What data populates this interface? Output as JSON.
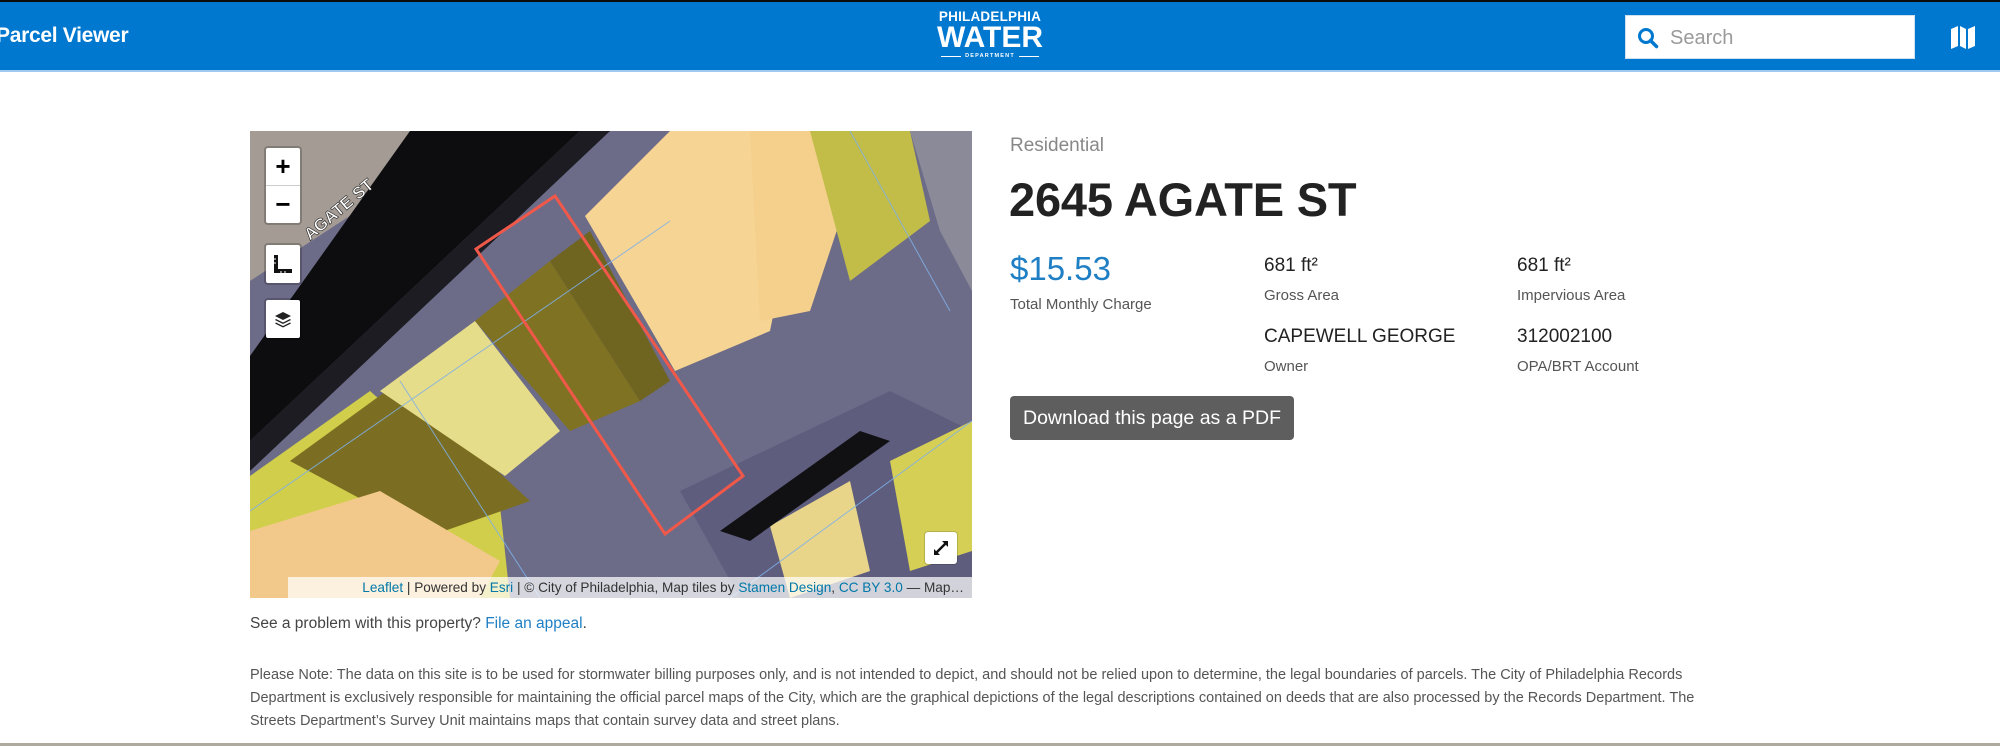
{
  "header": {
    "app_title": "Parcel Viewer",
    "logo": {
      "line1": "PHILADELPHIA",
      "line2": "WATER",
      "line3": "DEPARTMENT"
    },
    "search": {
      "placeholder": "Search",
      "value": "",
      "icon": "search-icon"
    },
    "map_button_icon": "map-icon",
    "colors": {
      "brand": "#0078cf"
    }
  },
  "map": {
    "street_label": "AGATE ST",
    "controls": {
      "zoom_in": "+",
      "zoom_out": "−",
      "measure_icon": "ruler-square-icon",
      "layers_icon": "layers-icon",
      "fullscreen_icon": "expand-icon"
    },
    "attribution": {
      "leaflet": "Leaflet",
      "sep1": " | Powered by ",
      "esri": "Esri",
      "sep2": " | © City of Philadelphia, Map tiles by ",
      "stamen": "Stamen Design",
      "sep3": ", ",
      "license": "CC BY 3.0",
      "tail": " — Map…"
    },
    "colors": {
      "selected_parcel_outline": "#f0584a",
      "parcel_fill": "#f6d494",
      "impervious_fill": "#c9c54a"
    }
  },
  "property": {
    "category": "Residential",
    "address": "2645 AGATE ST",
    "total_monthly_charge": {
      "value": "$15.53",
      "label": "Total Monthly Charge"
    },
    "gross_area": {
      "value": "681 ft²",
      "label": "Gross Area"
    },
    "impervious_area": {
      "value": "681 ft²",
      "label": "Impervious Area"
    },
    "owner": {
      "value": "CAPEWELL GEORGE",
      "label": "Owner"
    },
    "opa_account": {
      "value": "312002100",
      "label": "OPA/BRT Account"
    },
    "pdf_button": "Download this page as a PDF",
    "colors": {
      "charge": "#1f7fc4"
    }
  },
  "footer": {
    "problem_text": "See a problem with this property? ",
    "appeal_link": "File an appeal",
    "appeal_suffix": ".",
    "note": "Please Note: The data on this site is to be used for stormwater billing purposes only, and is not intended to depict, and should not be relied upon to determine, the legal boundaries of parcels. The City of Philadelphia Records Department is exclusively responsible for maintaining the official parcel maps of the City, which are the graphical depictions of the legal descriptions contained on deeds that are also processed by the Records Department. The Streets Department’s Survey Unit maintains maps that contain survey data and street plans."
  }
}
